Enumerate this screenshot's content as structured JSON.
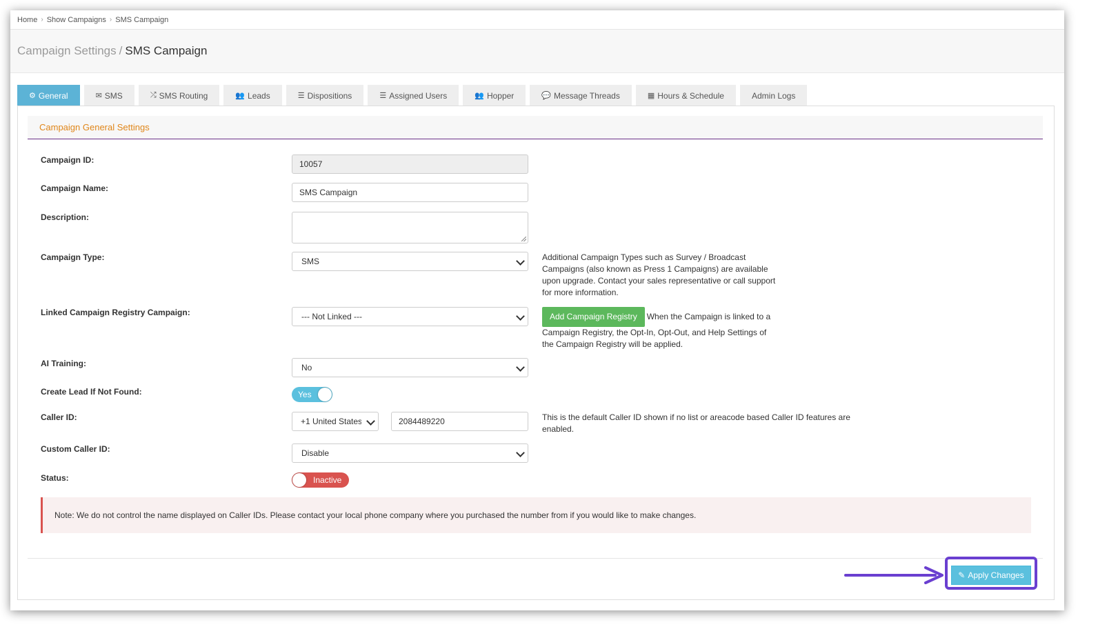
{
  "breadcrumb": [
    "Home",
    "Show Campaigns",
    "SMS Campaign"
  ],
  "header": {
    "section": "Campaign Settings",
    "title": "SMS Campaign"
  },
  "tabs": [
    {
      "label": "General",
      "icon": "gears-icon"
    },
    {
      "label": "SMS",
      "icon": "envelope-icon"
    },
    {
      "label": "SMS Routing",
      "icon": "random-icon"
    },
    {
      "label": "Leads",
      "icon": "users-icon"
    },
    {
      "label": "Dispositions",
      "icon": "list-icon"
    },
    {
      "label": "Assigned Users",
      "icon": "list-ol-icon"
    },
    {
      "label": "Hopper",
      "icon": "users-icon"
    },
    {
      "label": "Message Threads",
      "icon": "comments-icon"
    },
    {
      "label": "Hours & Schedule",
      "icon": "calendar-icon"
    },
    {
      "label": "Admin Logs",
      "icon": ""
    }
  ],
  "section_title": "Campaign General Settings",
  "form": {
    "campaign_id": {
      "label": "Campaign ID:",
      "value": "10057"
    },
    "campaign_name": {
      "label": "Campaign Name:",
      "value": "SMS Campaign"
    },
    "description": {
      "label": "Description:",
      "value": ""
    },
    "campaign_type": {
      "label": "Campaign Type:",
      "value": "SMS",
      "help": "Additional Campaign Types such as Survey / Broadcast Campaigns (also known as Press 1 Campaigns) are available upon upgrade. Contact your sales representative or call support for more information."
    },
    "linked_registry": {
      "label": "Linked Campaign Registry Campaign:",
      "value": "--- Not Linked ---",
      "button": "Add Campaign Registry",
      "help": "When the Campaign is linked to a Campaign Registry, the Opt-In, Opt-Out, and Help Settings of the Campaign Registry will be applied."
    },
    "ai_training": {
      "label": "AI Training:",
      "value": "No"
    },
    "create_lead": {
      "label": "Create Lead If Not Found:",
      "value": "Yes"
    },
    "caller_id": {
      "label": "Caller ID:",
      "country": "+1 United States",
      "number": "2084489220",
      "help": "This is the default Caller ID shown if no list or areacode based Caller ID features are enabled."
    },
    "custom_caller_id": {
      "label": "Custom Caller ID:",
      "value": "Disable"
    },
    "status": {
      "label": "Status:",
      "value": "Inactive"
    }
  },
  "note": "Note: We do not control the name displayed on Caller IDs. Please contact your local phone company where you purchased the number from if you would like to make changes.",
  "apply_button": "Apply Changes",
  "colors": {
    "tab_active": "#5cb3d6",
    "section_title": "#e0861a",
    "divider_purple": "#6a2f86",
    "btn_green": "#5cb85c",
    "toggle_yes": "#5bc0de",
    "toggle_inactive": "#d9534f",
    "highlight": "#6a3fd0",
    "apply": "#5bc0de"
  }
}
